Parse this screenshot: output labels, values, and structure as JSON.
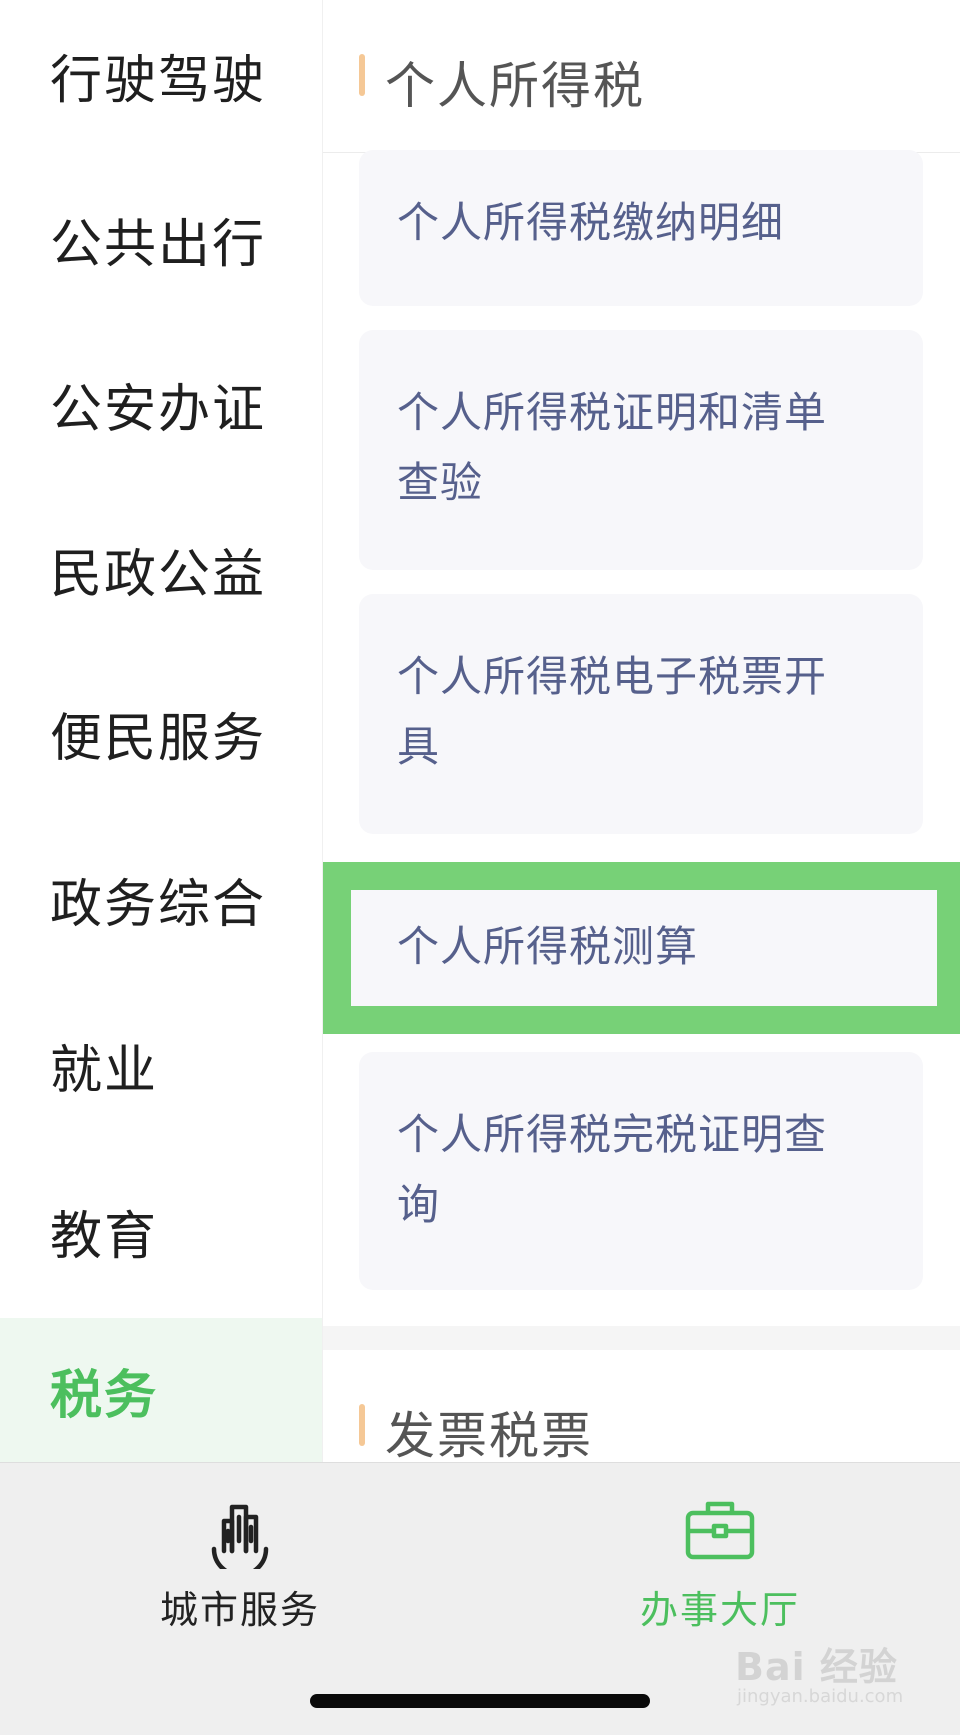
{
  "sidebar": {
    "items": [
      {
        "label": "行驶驾驶"
      },
      {
        "label": "公共出行"
      },
      {
        "label": "公安办证"
      },
      {
        "label": "民政公益"
      },
      {
        "label": "便民服务"
      },
      {
        "label": "政务综合"
      },
      {
        "label": "就业"
      },
      {
        "label": "教育"
      },
      {
        "label": "税务"
      }
    ],
    "active_label": "税务"
  },
  "main": {
    "sections": [
      {
        "title": "个人所得税",
        "items": [
          {
            "label": "个人所得税缴纳明细"
          },
          {
            "label": "个人所得税证明和清单查验"
          },
          {
            "label": "个人所得税电子税票开具"
          },
          {
            "label": "个人所得税测算"
          },
          {
            "label": "个人所得税完税证明查询"
          }
        ]
      },
      {
        "title": "发票税票"
      }
    ]
  },
  "tabbar": {
    "tabs": [
      {
        "label": "城市服务",
        "icon": "city-buildings-icon"
      },
      {
        "label": "办事大厅",
        "icon": "briefcase-icon"
      }
    ],
    "active_tab": "办事大厅"
  },
  "watermark": {
    "brand": "Bai 经验",
    "url": "jingyan.baidu.com"
  },
  "colors": {
    "accent_green": "#4cbf5e",
    "highlight_green": "#77d177",
    "section_accent": "#f5c896",
    "item_text": "#56608c"
  }
}
